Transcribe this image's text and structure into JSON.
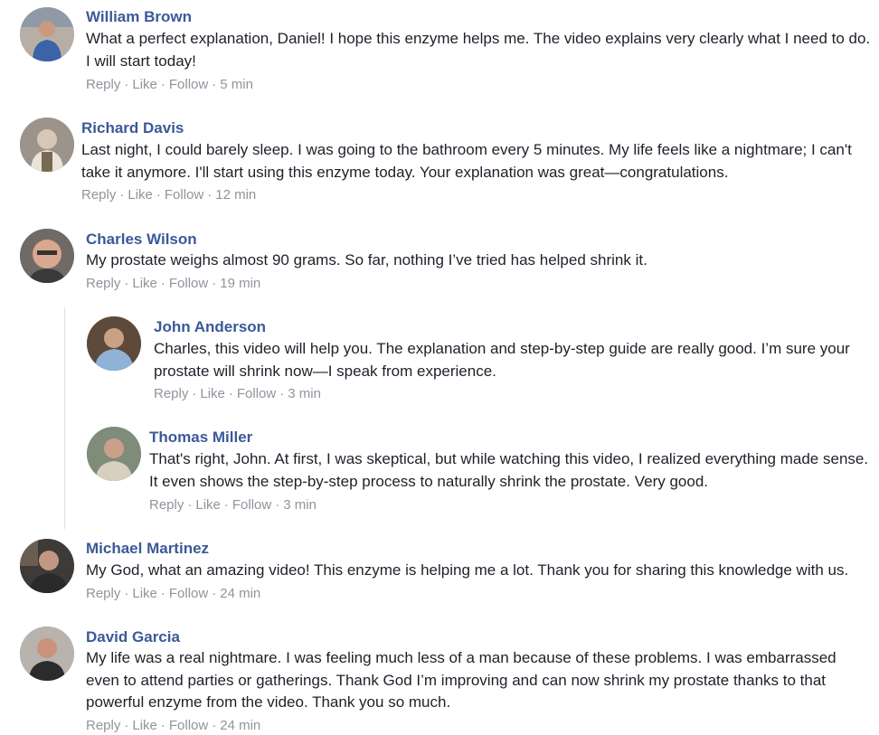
{
  "actions": {
    "reply": "Reply",
    "like": "Like",
    "follow": "Follow",
    "sep": "·"
  },
  "comments": [
    {
      "name": "William Brown",
      "text": "What a perfect explanation, Daniel! I hope this enzyme helps me. The video explains very clearly what I need to do. I will start today!",
      "time": "5 min"
    },
    {
      "name": "Richard Davis",
      "text": "Last night, I could barely sleep. I was going to the bathroom every 5 minutes. My life feels like a nightmare; I can't take it anymore. I'll start using this enzyme today. Your explanation was great—congratulations.",
      "time": "12 min"
    },
    {
      "name": "Charles Wilson",
      "text": "My prostate weighs almost 90 grams. So far, nothing I’ve tried has helped shrink it.",
      "time": "19 min"
    },
    {
      "name": "John Anderson",
      "text": "Charles, this video will help you. The explanation and step-by-step guide are really good. I’m sure your prostate will shrink now—I speak from experience.",
      "time": "3 min"
    },
    {
      "name": "Thomas Miller",
      "text": "That's right, John. At first, I was skeptical, but while watching this video, I realized everything made sense. It even shows the step-by-step process to naturally shrink the prostate. Very good.",
      "time": "3 min"
    },
    {
      "name": "Michael Martinez",
      "text": "My God, what an amazing video! This enzyme is helping me a lot. Thank you for sharing this knowledge with us.",
      "time": "24 min"
    },
    {
      "name": "David Garcia",
      "text": "My life was a real nightmare. I was feeling much less of a man because of these problems. I was embarrassed even to attend parties or gatherings. Thank God I’m improving and can now shrink my prostate thanks to that powerful enzyme from the video. Thank you so much.",
      "time": "24 min"
    }
  ]
}
